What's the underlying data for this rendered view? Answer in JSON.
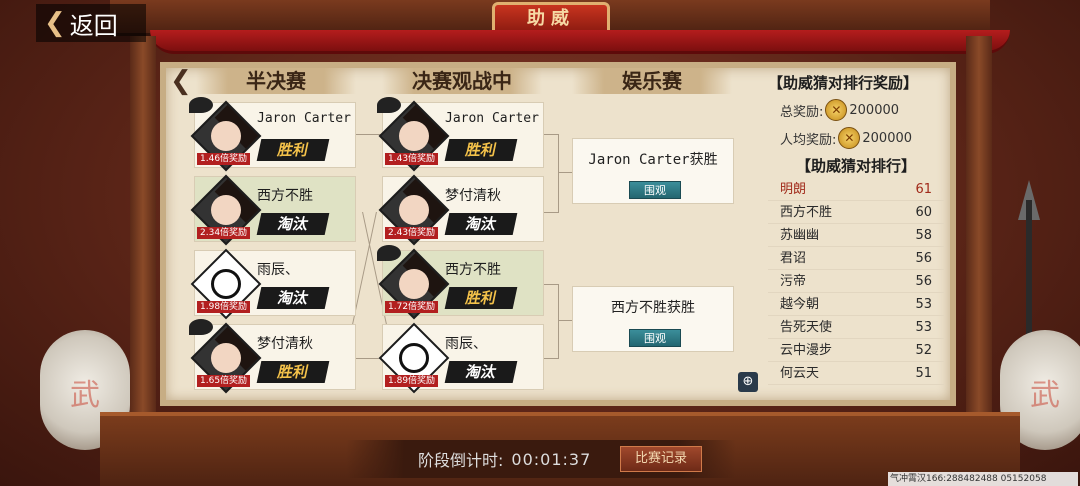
{
  "header": {
    "back_label": "返回",
    "title": "助威"
  },
  "bracket": {
    "columns": [
      "半决赛",
      "决赛观战中",
      "娱乐赛"
    ],
    "semis": [
      {
        "name": "Jaron Carter",
        "multiplier": "1.46倍奖励",
        "result": "胜利",
        "won": true
      },
      {
        "name": "西方不胜",
        "multiplier": "2.34倍奖励",
        "result": "淘汰",
        "won": false
      },
      {
        "name": "雨辰、",
        "multiplier": "1.98倍奖励",
        "result": "淘汰",
        "won": false
      },
      {
        "name": "梦付清秋",
        "multiplier": "1.65倍奖励",
        "result": "胜利",
        "won": true
      }
    ],
    "finals": [
      {
        "name": "Jaron Carter",
        "multiplier": "1.43倍奖励",
        "result": "胜利",
        "won": true
      },
      {
        "name": "梦付清秋",
        "multiplier": "2.43倍奖励",
        "result": "淘汰",
        "won": false
      },
      {
        "name": "西方不胜",
        "multiplier": "1.72倍奖励",
        "result": "胜利",
        "won": true
      },
      {
        "name": "雨辰、",
        "multiplier": "1.89倍奖励",
        "result": "淘汰",
        "won": false
      }
    ],
    "results": [
      {
        "text": "Jaron Carter获胜",
        "watch_label": "围观"
      },
      {
        "text": "西方不胜获胜",
        "watch_label": "围观"
      }
    ]
  },
  "side": {
    "reward_title": "【助威猜对排行奖励】",
    "total_reward_label": "总奖励:",
    "total_reward_value": "200000",
    "per_capita_label": "人均奖励:",
    "per_capita_value": "200000",
    "rank_title": "【助威猜对排行】",
    "ranks": [
      {
        "name": "明朗",
        "score": "61"
      },
      {
        "name": "西方不胜",
        "score": "60"
      },
      {
        "name": "苏幽幽",
        "score": "58"
      },
      {
        "name": "君诏",
        "score": "56"
      },
      {
        "name": "污帝",
        "score": "56"
      },
      {
        "name": "越今朝",
        "score": "53"
      },
      {
        "name": "告死天使",
        "score": "53"
      },
      {
        "name": "云中漫步",
        "score": "52"
      },
      {
        "name": "何云天",
        "score": "51"
      }
    ]
  },
  "footer": {
    "countdown_label": "阶段倒计时:",
    "countdown_time": "00:01:37",
    "record_button": "比赛记录",
    "watermark": "气冲霄汉166:288482488 05152058"
  },
  "decor": {
    "drum_glyph": "武"
  },
  "colors": {
    "win_badge": "#f4c24a",
    "accent_red": "#b21f1f",
    "watch_button": "#2f7a86"
  }
}
